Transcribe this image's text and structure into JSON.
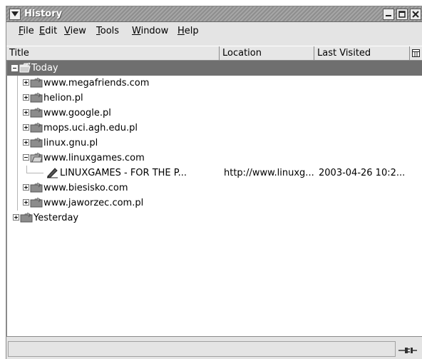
{
  "window": {
    "title": "History"
  },
  "menubar": {
    "items": [
      {
        "label": "File",
        "mnemonic": "F",
        "rest": "ile"
      },
      {
        "label": "Edit",
        "mnemonic": "E",
        "rest": "dit"
      },
      {
        "label": "View",
        "mnemonic": "V",
        "rest": "iew"
      },
      {
        "label": "Tools",
        "mnemonic": "T",
        "rest": "ools"
      },
      {
        "label": "Window",
        "mnemonic": "W",
        "rest": "indow"
      },
      {
        "label": "Help",
        "mnemonic": "H",
        "rest": "elp"
      }
    ]
  },
  "columns": {
    "title": "Title",
    "location": "Location",
    "last_visited": "Last Visited"
  },
  "tree": {
    "today": "Today",
    "sites": [
      "www.megafriends.com",
      "helion.pl",
      "www.google.pl",
      "mops.uci.agh.edu.pl",
      "linux.gnu.pl",
      "www.linuxgames.com"
    ],
    "entry": {
      "title": "LINUXGAMES - FOR THE P...",
      "location": "http://www.linuxg...",
      "last_visited": "2003-04-26 10:2..."
    },
    "sites_after": [
      "www.biesisko.com",
      "www.jaworzec.com.pl"
    ],
    "yesterday": "Yesterday"
  },
  "colors": {
    "selection": "#6f6f6f",
    "titlebar": "#9c9c9c",
    "window_bg": "#e4e4e4"
  },
  "icons": {
    "window_menu": "chevron-down-icon",
    "minimize": "minimize-icon",
    "maximize": "maximize-icon",
    "close": "close-icon",
    "folder": "folder-icon",
    "open_folder": "folder-open-icon",
    "bookmark": "bookmark-icon",
    "column_picker": "column-picker-icon",
    "offline": "offline-plug-icon"
  }
}
